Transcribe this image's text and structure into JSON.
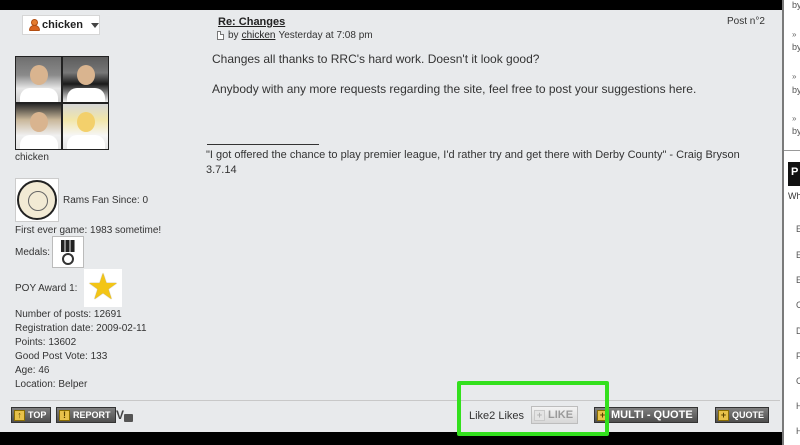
{
  "user": {
    "name": "chicken",
    "caption": "chicken",
    "fan_since": "Rams Fan Since: 0",
    "first_game": "First ever game: 1983 sometime!",
    "medals_label": "Medals:",
    "poy_label": "POY Award 1:",
    "stats": [
      "Number of posts: 12691",
      "Registration date: 2009-02-11",
      "Points: 13602",
      "Good Post Vote: 133",
      "Age: 46",
      "Location: Belper"
    ]
  },
  "post": {
    "title": "Re: Changes",
    "meta_by": "by",
    "meta_author": "chicken",
    "meta_time": "Yesterday at 7:08 pm",
    "number": "Post n°2",
    "paragraphs": [
      "Changes all thanks to RRC's hard work. Doesn't it look good?",
      "Anybody with any more requests regarding the site, feel free to post your suggestions here."
    ],
    "signature": "\"I got offered the chance to play premier league, I'd rather try and get there with Derby County\" - Craig Bryson 3.7.14"
  },
  "toolbar": {
    "top": "TOP",
    "report": "REPORT",
    "likes_text": "Like2 Likes",
    "like": "LIKE",
    "multiquote": "MULTI - QUOTE",
    "quote": "QUOTE"
  },
  "sidebar": {
    "by_items": [
      "by",
      "by",
      "by",
      "by"
    ],
    "chevrons": [
      "»",
      "»",
      "»"
    ],
    "header": "P",
    "sub": "Wh",
    "list_letters": [
      "E",
      "E",
      "E",
      "C",
      "D",
      "F",
      "C",
      "H",
      "H"
    ]
  },
  "colors": {
    "post_bg": "#e8eaec",
    "button_bg": "#5e5e5e",
    "highlight": "#33e01d",
    "star": "#f3c516"
  }
}
